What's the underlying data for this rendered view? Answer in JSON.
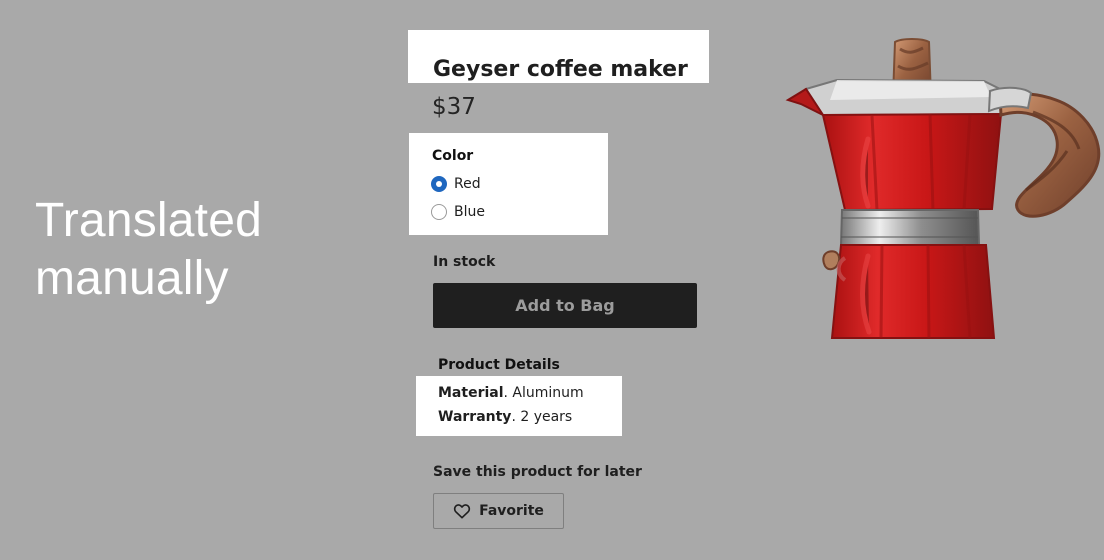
{
  "overlay": {
    "note": "Translated manually"
  },
  "product": {
    "title": "Geyser coffee maker",
    "price": "$37",
    "image_icon": "moka-pot-image"
  },
  "color_selector": {
    "label": "Color",
    "options": [
      {
        "label": "Red",
        "selected": true
      },
      {
        "label": "Blue",
        "selected": false
      }
    ]
  },
  "availability": {
    "status": "In stock"
  },
  "actions": {
    "add_to_bag": "Add to Bag",
    "save_for_later": "Save this product for later",
    "favorite": "Favorite",
    "favorite_icon": "heart-icon"
  },
  "details": {
    "heading": "Product Details",
    "items": [
      {
        "label": "Material",
        "value": ". Aluminum"
      },
      {
        "label": "Warranty",
        "value": ". 2 years"
      }
    ]
  },
  "colors": {
    "page_background": "#a9a9a9",
    "highlight_background": "#ffffff",
    "selected_radio": "#1f67bf",
    "button_dark": "#1f1f1f",
    "product_red": "#d01f1f",
    "product_wood": "#9b6242",
    "product_steel": "#c7c7c7"
  }
}
